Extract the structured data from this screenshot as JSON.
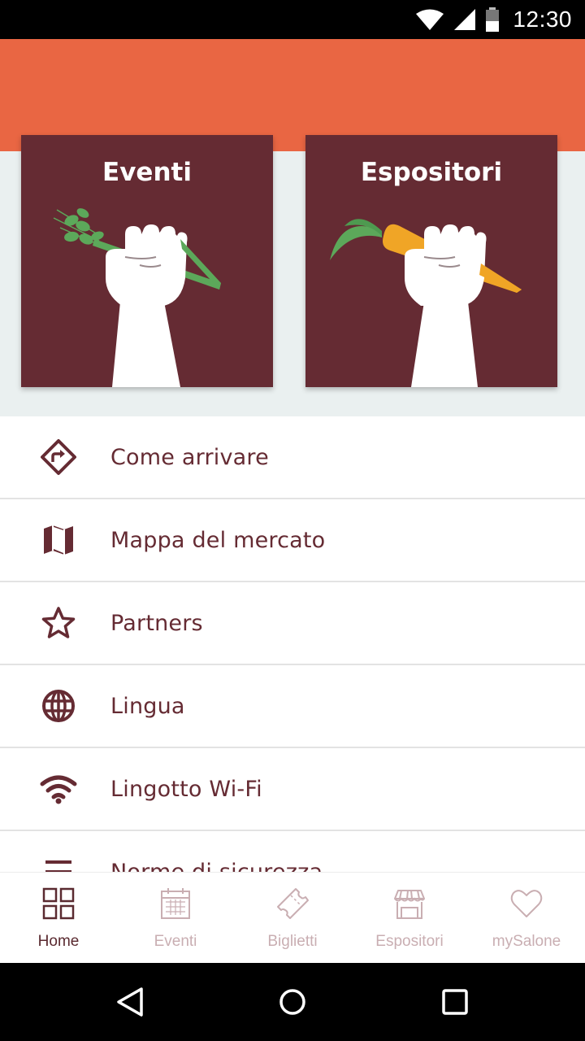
{
  "status_bar": {
    "time": "12:30"
  },
  "tiles": [
    {
      "title": "Eventi"
    },
    {
      "title": "Espositori"
    }
  ],
  "menu": {
    "items": [
      {
        "label": "Come arrivare",
        "icon": "directions-icon"
      },
      {
        "label": "Mappa del mercato",
        "icon": "map-icon"
      },
      {
        "label": "Partners",
        "icon": "star-icon"
      },
      {
        "label": "Lingua",
        "icon": "globe-icon"
      },
      {
        "label": "Lingotto Wi-Fi",
        "icon": "wifi-icon"
      },
      {
        "label": "Norme di sicurezza",
        "icon": "menu-lines-icon"
      }
    ]
  },
  "bottom_nav": {
    "items": [
      {
        "label": "Home",
        "icon": "grid-icon",
        "active": true
      },
      {
        "label": "Eventi",
        "icon": "calendar-icon",
        "active": false
      },
      {
        "label": "Biglietti",
        "icon": "ticket-icon",
        "active": false
      },
      {
        "label": "Espositori",
        "icon": "market-stall-icon",
        "active": false
      },
      {
        "label": "mySalone",
        "icon": "heart-icon",
        "active": false
      }
    ]
  },
  "colors": {
    "header": "#E96643",
    "tile": "#652B33",
    "accent_text": "#652B33",
    "inactive_nav": "#C9AEB2"
  }
}
